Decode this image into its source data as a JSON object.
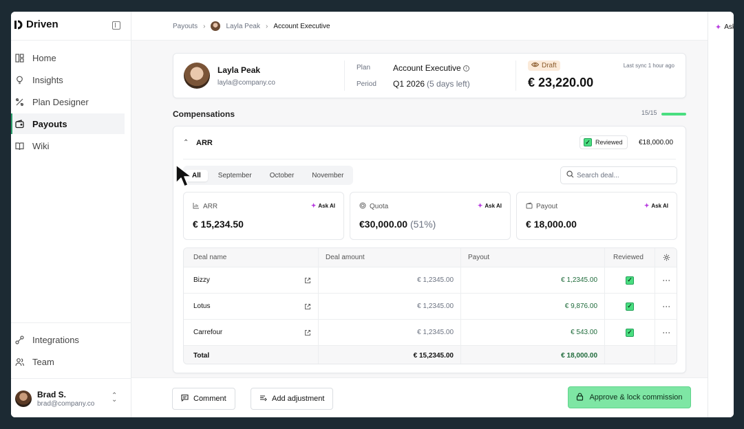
{
  "app": {
    "name": "Driven"
  },
  "sidebar": {
    "items": [
      {
        "label": "Home",
        "icon": "home-icon"
      },
      {
        "label": "Insights",
        "icon": "lightbulb-icon"
      },
      {
        "label": "Plan Designer",
        "icon": "plan-designer-icon"
      },
      {
        "label": "Payouts",
        "icon": "wallet-icon",
        "active": true
      },
      {
        "label": "Wiki",
        "icon": "book-icon"
      }
    ],
    "bottom_items": [
      {
        "label": "Integrations",
        "icon": "integrations-icon"
      },
      {
        "label": "Team",
        "icon": "team-icon"
      }
    ],
    "user": {
      "name": "Brad S.",
      "email": "brad@company.co"
    }
  },
  "breadcrumb": {
    "root": "Payouts",
    "person": "Layla Peak",
    "current": "Account Executive"
  },
  "right_panel": {
    "ask_label": "Ask AI"
  },
  "employee": {
    "name": "Layla Peak",
    "email": "layla@company.co",
    "plan_label": "Plan",
    "plan_value": "Account Executive",
    "period_label": "Period",
    "period_value": "Q1 2026",
    "period_note": "(5 days left)",
    "status": "Draft",
    "last_sync": "Last sync 1 hour ago",
    "total": "€ 23,220.00"
  },
  "compensations": {
    "title": "Compensations",
    "progress_text": "15/15",
    "progress_fraction": 1.0,
    "group": {
      "title": "ARR",
      "reviewed_label": "Reviewed",
      "total": "€18,000.00",
      "tabs": [
        "All",
        "September",
        "October",
        "November"
      ],
      "active_tab": "All",
      "search_placeholder": "Search deal...",
      "metrics": [
        {
          "label": "ARR",
          "icon": "bar-chart-icon",
          "ask": "Ask AI",
          "value": "€ 15,234.50",
          "note": ""
        },
        {
          "label": "Quota",
          "icon": "target-icon",
          "ask": "Ask AI",
          "value": "€30,000.00",
          "note": "(51%)"
        },
        {
          "label": "Payout",
          "icon": "wallet-icon",
          "ask": "Ask AI",
          "value": "€ 18,000.00",
          "note": ""
        }
      ],
      "table": {
        "columns": [
          "Deal name",
          "Deal amount",
          "Payout",
          "Reviewed"
        ],
        "rows": [
          {
            "name": "Bizzy",
            "amount": "€ 1,2345.00",
            "payout": "€ 1,2345.00"
          },
          {
            "name": "Lotus",
            "amount": "€ 1,2345.00",
            "payout": "€ 9,876.00"
          },
          {
            "name": "Carrefour",
            "amount": "€ 1,2345.00",
            "payout": "€ 543.00"
          }
        ],
        "total": {
          "label": "Total",
          "amount": "€ 15,2345.00",
          "payout": "€ 18,000.00"
        }
      }
    }
  },
  "footer": {
    "comment_label": "Comment",
    "adjustment_label": "Add adjustment",
    "approve_label": "Approve & lock commission"
  },
  "colors": {
    "accent": "#4ade80",
    "primary_button": "#7ee6a4",
    "draft": "#fbead9",
    "payout_green": "#1f6b3b"
  }
}
